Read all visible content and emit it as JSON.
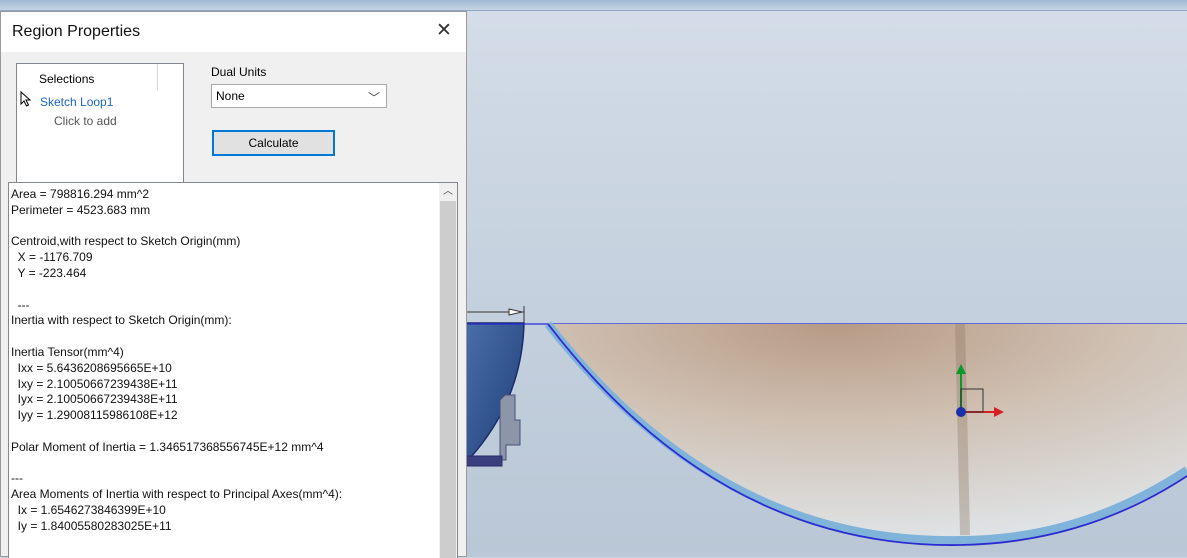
{
  "dialog": {
    "title": "Region Properties",
    "close_glyph": "✕",
    "selections_header": "Selections",
    "selection_item": "Sketch Loop1",
    "click_to_add": "Click to add",
    "dual_units_label": "Dual Units",
    "dual_units_value": "None",
    "dual_units_chevron": "﹀",
    "calculate_label": "Calculate"
  },
  "results": {
    "lines": [
      "Area = 798816.294 mm^2",
      "Perimeter = 4523.683 mm",
      "",
      "Centroid,with respect to Sketch Origin(mm)",
      "  X = -1176.709",
      "  Y = -223.464",
      "",
      "  ---",
      "Inertia with respect to Sketch Origin(mm):",
      "",
      "Inertia Tensor(mm^4)",
      "  Ixx = 5.6436208695665E+10",
      "  Ixy = 2.10050667239438E+11",
      "  Iyx = 2.10050667239438E+11",
      "  Iyy = 1.29008115986108E+12",
      "",
      "Polar Moment of Inertia = 1.346517368556745E+12 mm^4",
      "",
      "---",
      "Area Moments of Inertia with respect to Principal Axes(mm^4):",
      "  Ix = 1.6546273846399E+10",
      "  Iy = 1.84005580283025E+11"
    ],
    "scroll_up_glyph": "︿"
  },
  "colors": {
    "accent": "#0078d7",
    "link": "#1a64c8",
    "sketch_edge": "#2b2bd1"
  }
}
